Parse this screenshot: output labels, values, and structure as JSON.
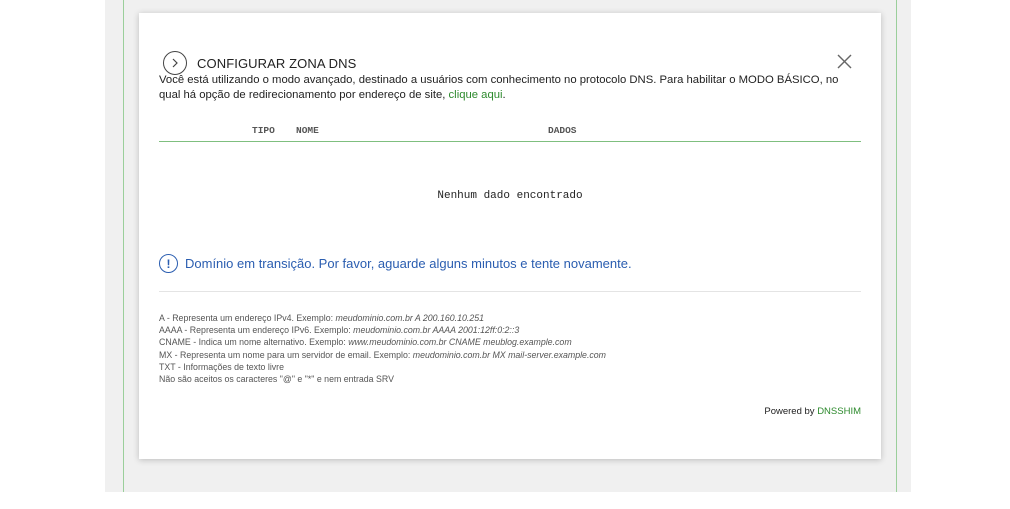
{
  "modal": {
    "title": "CONFIGURAR ZONA DNS",
    "intro_text": "Você está utilizando o modo avançado, destinado a usuários com conhecimento no protocolo DNS. Para habilitar o MODO BÁSICO, no qual há opção de redirecionamento por endereço de site, ",
    "intro_link": "clique aqui",
    "intro_end": "."
  },
  "table": {
    "columns": [
      "TIPO",
      "NOME",
      "DADOS"
    ],
    "empty_message": "Nenhum dado encontrado"
  },
  "alert": {
    "icon": "!",
    "message": "Domínio em transição. Por favor, aguarde alguns minutos e tente novamente."
  },
  "legend": [
    {
      "label": "A - Representa um endereço IPv4. Exemplo: ",
      "example": "meudominio.com.br A 200.160.10.251"
    },
    {
      "label": "AAAA - Representa um endereço IPv6. Exemplo: ",
      "example": "meudominio.com.br AAAA 2001:12ff:0:2::3"
    },
    {
      "label": "CNAME - Indica um nome alternativo. Exemplo: ",
      "example": "www.meudominio.com.br CNAME meublog.example.com"
    },
    {
      "label": "MX - Representa um nome para um servidor de email. Exemplo: ",
      "example": "meudominio.com.br MX mail-server.example.com"
    },
    {
      "label": "TXT - Informações de texto livre",
      "example": ""
    },
    {
      "label": "Não são aceitos os caracteres \"@\" e \"*\" e nem entrada SRV",
      "example": ""
    }
  ],
  "footer": {
    "powered_by": "Powered by ",
    "brand": "DNSSHIM"
  },
  "colors": {
    "accent_green": "#2d8a2d",
    "alert_blue": "#2a5db0"
  },
  "icons": {
    "expand": "chevron-right-icon",
    "close": "close-icon",
    "alert": "info-icon"
  }
}
